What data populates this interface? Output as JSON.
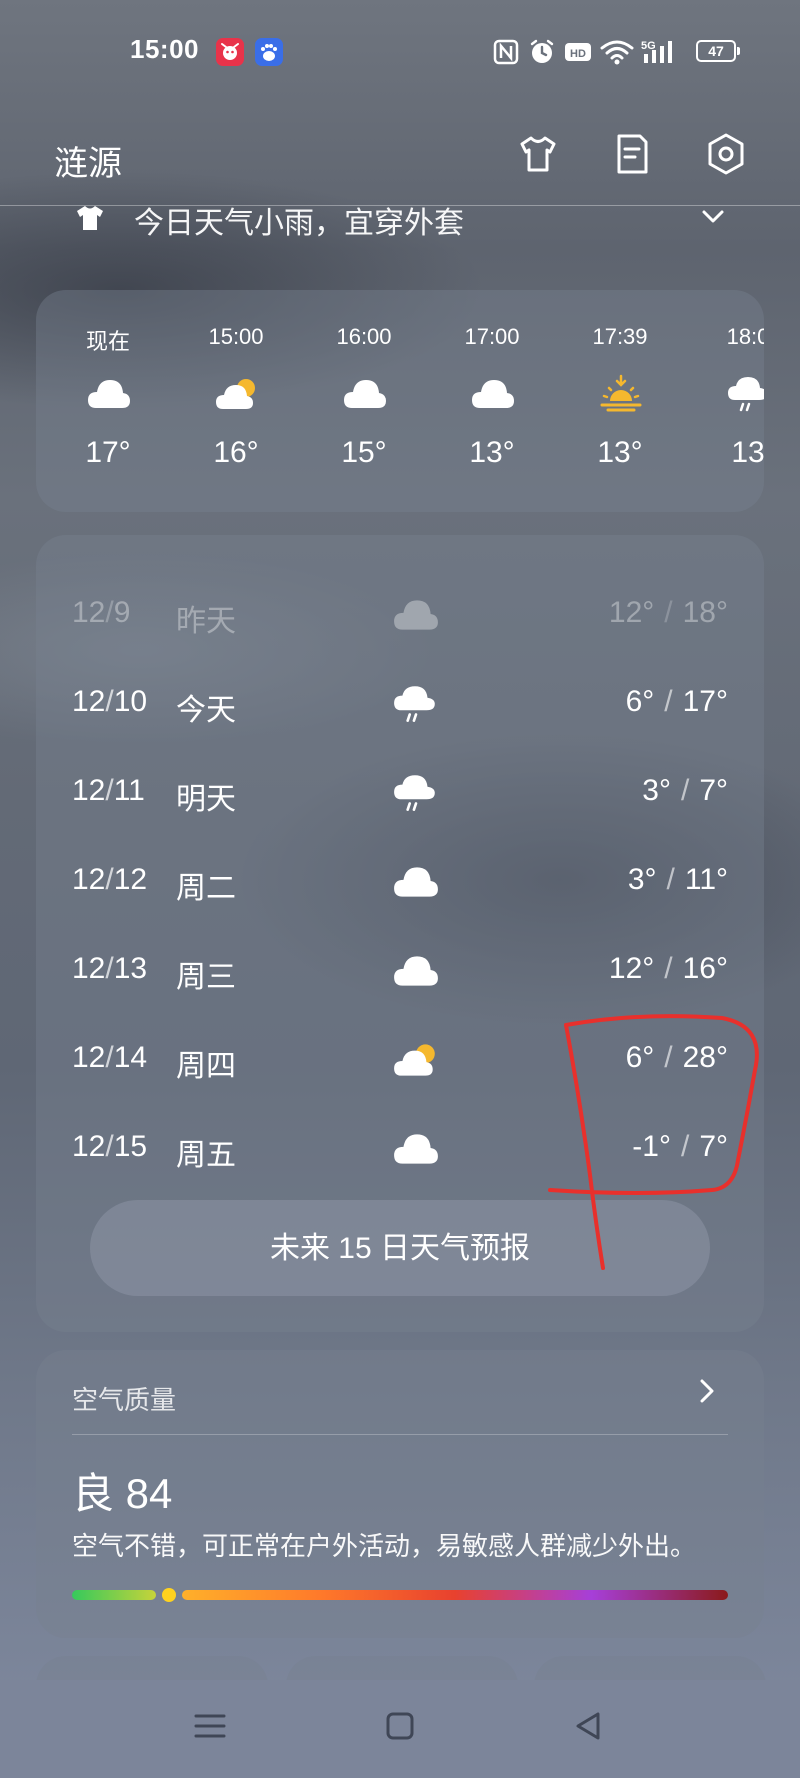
{
  "status_bar": {
    "time": "15:00",
    "battery": "47",
    "icons": [
      "app-badge-icon",
      "baidu-icon",
      "nfc-icon",
      "alarm-icon",
      "hd-icon",
      "wifi-icon",
      "5g-signal-icon",
      "battery-icon"
    ]
  },
  "header": {
    "city": "涟源",
    "icons": [
      "tshirt-icon",
      "document-icon",
      "settings-icon"
    ]
  },
  "tip": {
    "text": "今日天气小雨，宜穿外套"
  },
  "hourly": [
    {
      "time": "现在",
      "icon": "cloudy-icon",
      "temp": "17°"
    },
    {
      "time": "15:00",
      "icon": "partly-cloudy-icon",
      "temp": "16°"
    },
    {
      "time": "16:00",
      "icon": "cloudy-icon",
      "temp": "15°"
    },
    {
      "time": "17:00",
      "icon": "cloudy-icon",
      "temp": "13°"
    },
    {
      "time": "17:39",
      "icon": "sunset-icon",
      "temp": "13°"
    },
    {
      "time": "18:0",
      "icon": "rain-icon",
      "temp": "13"
    }
  ],
  "daily": [
    {
      "date_m": "12",
      "date_d": "9",
      "name": "昨天",
      "icon": "cloudy-icon",
      "low": "12°",
      "high": "18°"
    },
    {
      "date_m": "12",
      "date_d": "10",
      "name": "今天",
      "icon": "rain-icon",
      "low": "6°",
      "high": "17°"
    },
    {
      "date_m": "12",
      "date_d": "11",
      "name": "明天",
      "icon": "rain-icon",
      "low": "3°",
      "high": "7°"
    },
    {
      "date_m": "12",
      "date_d": "12",
      "name": "周二",
      "icon": "cloudy-icon",
      "low": "3°",
      "high": "11°"
    },
    {
      "date_m": "12",
      "date_d": "13",
      "name": "周三",
      "icon": "cloudy-icon",
      "low": "12°",
      "high": "16°"
    },
    {
      "date_m": "12",
      "date_d": "14",
      "name": "周四",
      "icon": "partly-cloudy-icon",
      "low": "6°",
      "high": "28°"
    },
    {
      "date_m": "12",
      "date_d": "15",
      "name": "周五",
      "icon": "cloudy-icon",
      "low": "-1°",
      "high": "7°"
    }
  ],
  "separator": "/",
  "forecast_button": "未来 15 日天气预报",
  "air_quality": {
    "title": "空气质量",
    "level": "良 84",
    "description": "空气不错，可正常在户外活动，易敏感人群减少外出。"
  },
  "colors": {
    "sun": "#F5B82E",
    "annotation": "#E8302C"
  }
}
